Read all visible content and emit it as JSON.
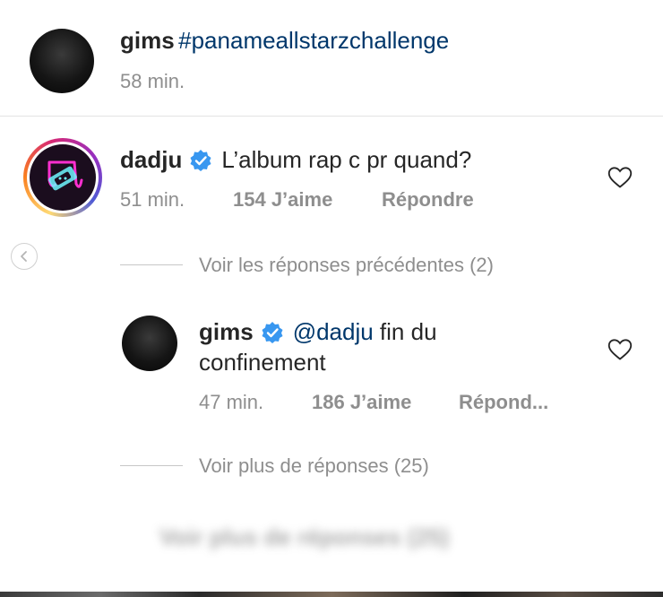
{
  "caption": {
    "username": "gims",
    "hashtag": "#panameallstarzchallenge",
    "time": "58 min."
  },
  "comment": {
    "username": "dadju",
    "text": "L’album rap c pr quand?",
    "time": "51 min.",
    "likes": "154 J’aime",
    "reply_label": "Répondre"
  },
  "view_previous_replies": "Voir les réponses précédentes (2)",
  "reply": {
    "username": "gims",
    "mention": "@dadju",
    "text_line1": " fin du",
    "text_line2": "confinement",
    "time": "47 min.",
    "likes": "186 J’aime",
    "reply_label": "Répond..."
  },
  "view_more_replies": "Voir plus de réponses (25)",
  "view_more_replies_blurred": "Voir plus de réponses (25)",
  "icons": {
    "verified": "verified-badge-icon",
    "heart": "heart-icon",
    "back": "chevron-left-icon"
  },
  "colors": {
    "verified": "#3897f0",
    "link": "#00376b",
    "secondary": "#8e8e8e",
    "neon_pink": "#ff2fd0"
  }
}
